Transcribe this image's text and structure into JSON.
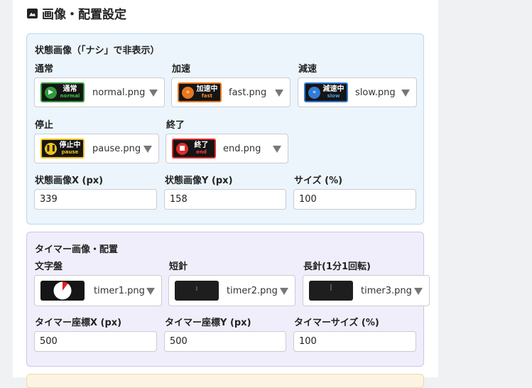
{
  "page": {
    "title": "画像・配置設定",
    "title_icon": "image-icon"
  },
  "status_section": {
    "title": "状態画像（「ナシ」で非表示）",
    "selects": [
      {
        "label": "通常",
        "thumb_text": "通常",
        "thumb_sub": "normal",
        "file": "normal.png",
        "color": "#2e9b3a",
        "icon": "play-icon"
      },
      {
        "label": "加速",
        "thumb_text": "加速中",
        "thumb_sub": "fast",
        "file": "fast.png",
        "color": "#e8771d",
        "icon": "fast-forward-icon"
      },
      {
        "label": "減速",
        "thumb_text": "減速中",
        "thumb_sub": "slow",
        "file": "slow.png",
        "color": "#2f7bd6",
        "icon": "rewind-icon"
      },
      {
        "label": "停止",
        "thumb_text": "停止中",
        "thumb_sub": "pause",
        "file": "pause.png",
        "color": "#f2c318",
        "icon": "pause-icon"
      },
      {
        "label": "終了",
        "thumb_text": "終了",
        "thumb_sub": "end",
        "file": "end.png",
        "color": "#e12a2a",
        "icon": "stop-icon"
      }
    ],
    "inputs": [
      {
        "label": "状態画像X (px)",
        "value": "339"
      },
      {
        "label": "状態画像Y (px)",
        "value": "158"
      },
      {
        "label": "サイズ (%)",
        "value": "100"
      }
    ]
  },
  "timer_section": {
    "title": "タイマー画像・配置",
    "selects": [
      {
        "label": "文字盤",
        "file": "timer1.png"
      },
      {
        "label": "短針",
        "file": "timer2.png"
      },
      {
        "label": "長針(1分1回転)",
        "file": "timer3.png"
      }
    ],
    "inputs": [
      {
        "label": "タイマー座標X (px)",
        "value": "500"
      },
      {
        "label": "タイマー座標Y (px)",
        "value": "500"
      },
      {
        "label": "タイマーサイズ (%)",
        "value": "100"
      }
    ]
  }
}
